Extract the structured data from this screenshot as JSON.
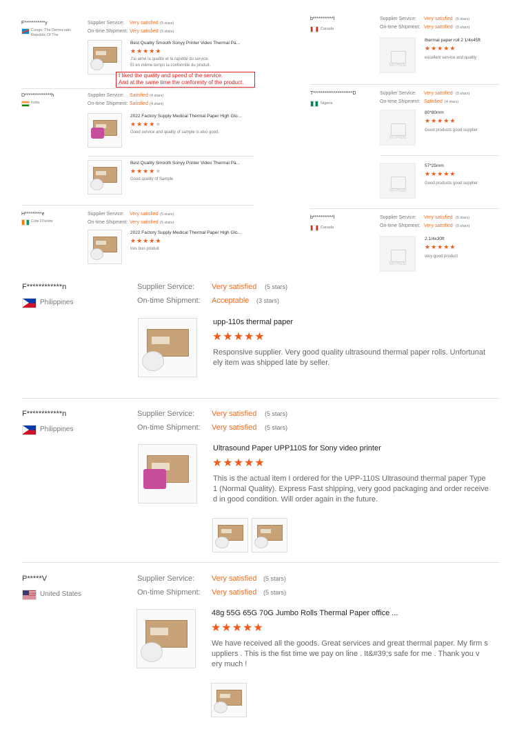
{
  "labels": {
    "service": "Supplier Service:",
    "shipment": "On-time Shipment:",
    "no_photo": "No Photo"
  },
  "small_left": [
    {
      "name": "F***********y",
      "country": "Congo, The Democratic Republic Of The",
      "service": "Very satisfied",
      "service_stars": "(5 stars)",
      "shipment": "Very satisfied",
      "shipment_stars": "(5 stars)",
      "items": [
        {
          "title": "Best Quality Smooth Sonyy Printer Video Thermal Pa...",
          "stars": 5,
          "text1": "J'ai aimé la qualité et la rapidité du service.",
          "text2": "Et en même temps la conformité du produit."
        }
      ],
      "translation_line1": "I liked the quality and speed of the service.",
      "translation_line2": "And at the same time the conformity of the product."
    },
    {
      "name": "D**************h",
      "country": "India",
      "service": "Satisfied",
      "service_stars": "(4 stars)",
      "shipment": "Satisfied",
      "shipment_stars": "(4 stars)",
      "items": [
        {
          "title": "2022 Factory Supply Medical Thermal Paper High Glo...",
          "stars": 4,
          "text1": "Good service and quality of sample is also good."
        },
        {
          "title": "Best Quality Smooth Sonyy Printer Video Thermal Pa...",
          "stars": 4,
          "text1": "Good quality of Sample"
        }
      ]
    },
    {
      "name": "H*********e",
      "country": "Cote D'Ivoire",
      "service": "Very satisfied",
      "service_stars": "(5 stars)",
      "shipment": "Very satisfied",
      "shipment_stars": "(5 stars)",
      "items": [
        {
          "title": "2022 Factory Supply Medical Thermal Paper High Glo...",
          "stars": 5,
          "text1": "tres bon produit"
        }
      ]
    }
  ],
  "small_right": [
    {
      "name": "b***********l",
      "country": "Canada",
      "service": "Very satisfied",
      "service_stars": "(5 stars)",
      "shipment": "Very satisfied",
      "shipment_stars": "(5 stars)",
      "items": [
        {
          "title": "thermal paper roll 2 1/4x45ft",
          "stars": 5,
          "text1": "excellent service and quality"
        }
      ]
    },
    {
      "name": "T*********************D",
      "country": "Nigeria",
      "service": "Very satisfied",
      "service_stars": "(5 stars)",
      "shipment": "Satisfied",
      "shipment_stars": "(4 stars)",
      "items": [
        {
          "title": "80*80mm",
          "stars": 5,
          "text1": "Good products good supplier"
        },
        {
          "title": "57*25mm",
          "stars": 5,
          "text1": "Good products good supplier"
        }
      ]
    },
    {
      "name": "b***********l",
      "country": "Canada",
      "service": "Very satisfied",
      "service_stars": "(5 stars)",
      "shipment": "Very satisfied",
      "shipment_stars": "(5 stars)",
      "items": [
        {
          "title": "2.1/4x30ft",
          "stars": 5,
          "text1": "very good product"
        }
      ]
    }
  ],
  "big": [
    {
      "name": "F************n",
      "country": "Philippines",
      "service": "Very satisfied",
      "service_stars": "(5 stars)",
      "shipment": "Acceptable",
      "shipment_stars": "(3 stars)",
      "title": "upp-110s thermal paper",
      "stars": 5,
      "text": [
        "Responsive supplier. Very good quality ultrasound thermal paper rolls. Unfortunat",
        "ely item was shipped late by seller."
      ]
    },
    {
      "name": "F************n",
      "country": "Philippines",
      "service": "Very satisfied",
      "service_stars": "(5 stars)",
      "shipment": "Very satisfied",
      "shipment_stars": "(5 stars)",
      "title": "Ultrasound Paper UPP110S for Sony video printer",
      "stars": 5,
      "text": [
        "This is the actual item I ordered for the UPP-110S Ultrasound thermal paper Type",
        "1 (Normal Quality). Express Fast shipping, very good packaging and order receive",
        "d in good condition. Will order again in the future."
      ]
    },
    {
      "name": "P*****V",
      "country": "United States",
      "service": "Very satisfied",
      "service_stars": "(5 stars)",
      "shipment": "Very satisfied",
      "shipment_stars": "(5 stars)",
      "title": "48g 55G 65G 70G Jumbo Rolls Thermal Paper office ...",
      "stars": 5,
      "text": [
        "We have received all the goods. Great services and great thermal paper. My firm s",
        "uppliers .  This is the fist time we pay on line .  It&#39;s safe for me .  Thank you v",
        "ery much !"
      ]
    }
  ],
  "colors": {
    "accent": "#f06d1f",
    "star": "#f05a1a",
    "highlight_box": "#e02020"
  },
  "icons": {
    "star": "★",
    "flag_congo": "flag-icon",
    "no_photo": "image-placeholder-icon"
  }
}
